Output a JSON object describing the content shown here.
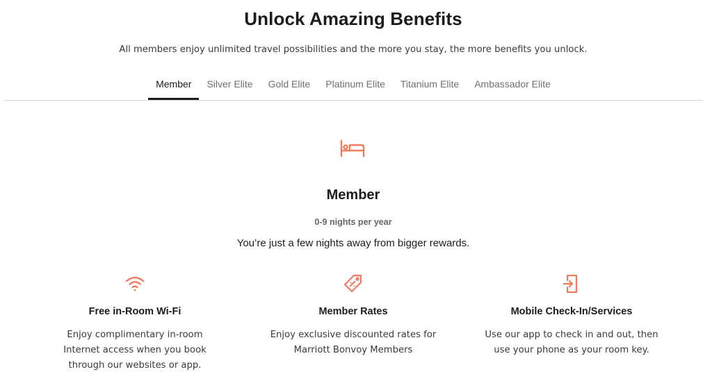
{
  "header": {
    "title": "Unlock Amazing Benefits",
    "subtitle": "All members enjoy unlimited travel possibilities and the more you stay, the more benefits you unlock."
  },
  "tabs": [
    {
      "label": "Member",
      "active": true
    },
    {
      "label": "Silver Elite",
      "active": false
    },
    {
      "label": "Gold Elite",
      "active": false
    },
    {
      "label": "Platinum Elite",
      "active": false
    },
    {
      "label": "Titanium Elite",
      "active": false
    },
    {
      "label": "Ambassador Elite",
      "active": false
    }
  ],
  "tier": {
    "icon": "bed-icon",
    "name": "Member",
    "nights": "0-9 nights per year",
    "message": "You’re just a few nights away from bigger rewards."
  },
  "benefits": [
    {
      "icon": "wifi-icon",
      "title": "Free in-Room Wi-Fi",
      "description": "Enjoy complimentary in-room Internet access when you book through our websites or app."
    },
    {
      "icon": "tag-icon",
      "title": "Member Rates",
      "description": "Enjoy exclusive discounted rates for Marriott Bonvoy Members"
    },
    {
      "icon": "mobile-check-in-icon",
      "title": "Mobile Check-In/Services",
      "description": "Use our app to check in and out, then use your phone as your room key."
    }
  ],
  "colors": {
    "accent": "#f07b5c",
    "text": "#1c1c1c",
    "muted": "#707070",
    "divider": "#d6d6d6"
  }
}
